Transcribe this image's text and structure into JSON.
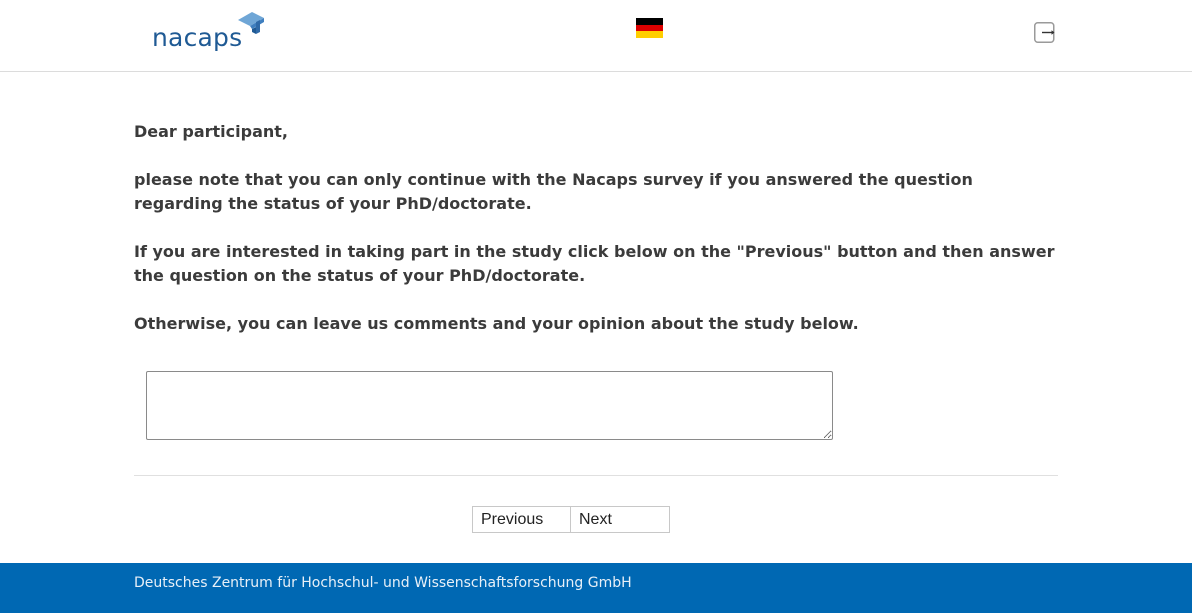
{
  "header": {
    "logo_text": "nacaps",
    "flag_colors": [
      "#000000",
      "#dd0000",
      "#ffce00"
    ],
    "language_icon": "german-flag-icon",
    "logout_icon": "logout-icon"
  },
  "main": {
    "paragraphs": [
      "Dear participant,",
      "please note that you can only continue with the Nacaps survey if you answered the question regarding the status of your PhD/doctorate.",
      "If you are interested in taking part in the study click below on the \"Previous\" button and then answer the question on the status of your PhD/doctorate.",
      "Otherwise, you can leave us comments and your opinion about the study below."
    ],
    "comment_value": "",
    "comment_placeholder": ""
  },
  "navigation": {
    "previous_label": "Previous",
    "next_label": "Next"
  },
  "footer": {
    "text": "Deutsches Zentrum für Hochschul- und Wissenschaftsforschung GmbH"
  },
  "colors": {
    "brand_blue": "#1f5a94",
    "footer_blue": "#0068b3",
    "logo_accent": "#5b9bd5"
  }
}
